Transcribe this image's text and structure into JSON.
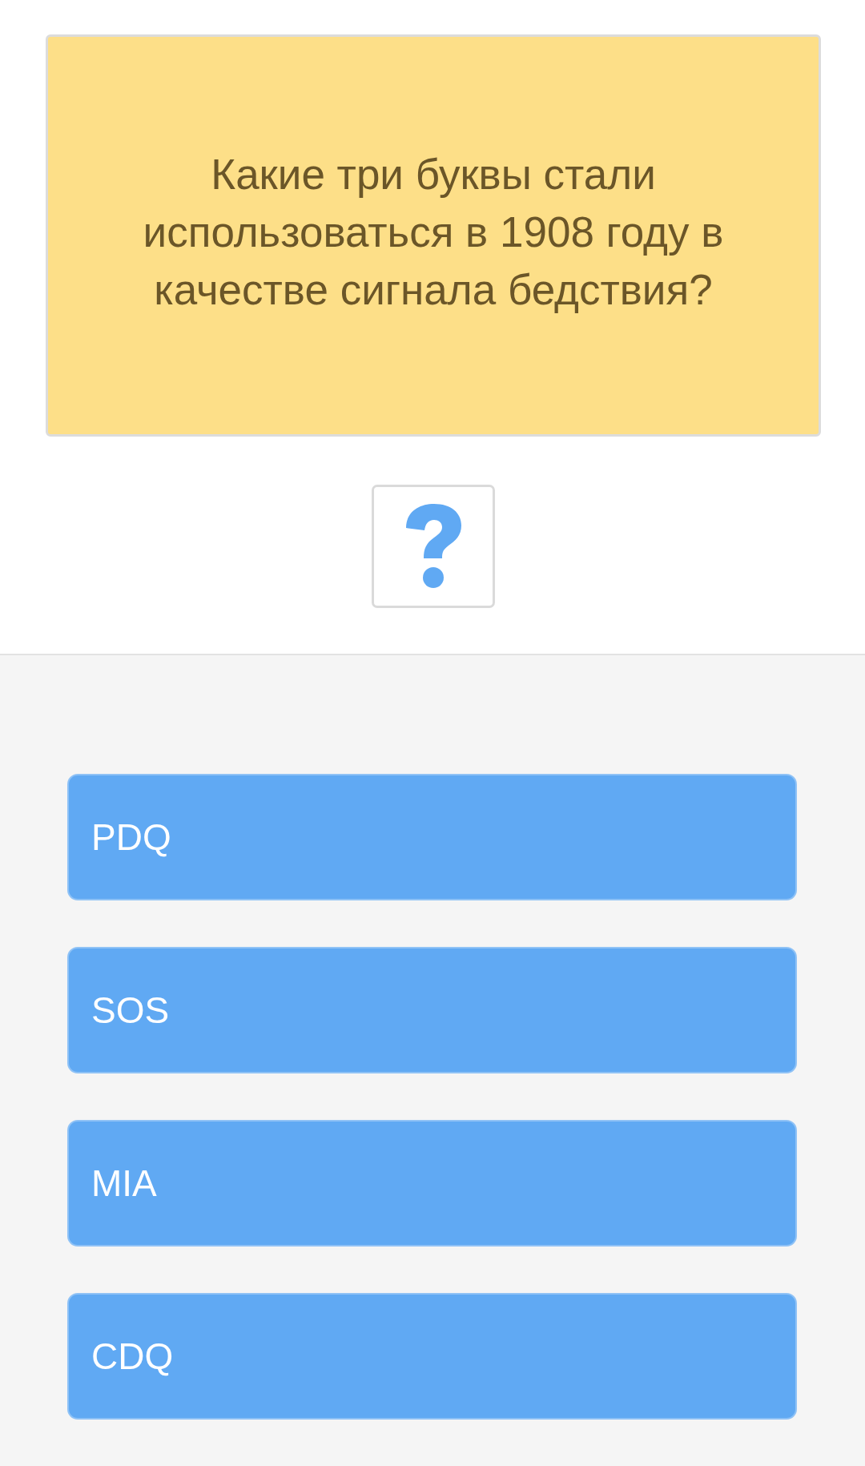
{
  "question": {
    "text": "Какие три буквы стали использоваться в 1908 году в качестве сигнала бедствия?"
  },
  "answers": [
    {
      "label": "PDQ"
    },
    {
      "label": "SOS"
    },
    {
      "label": "MIA"
    },
    {
      "label": "CDQ"
    }
  ]
}
